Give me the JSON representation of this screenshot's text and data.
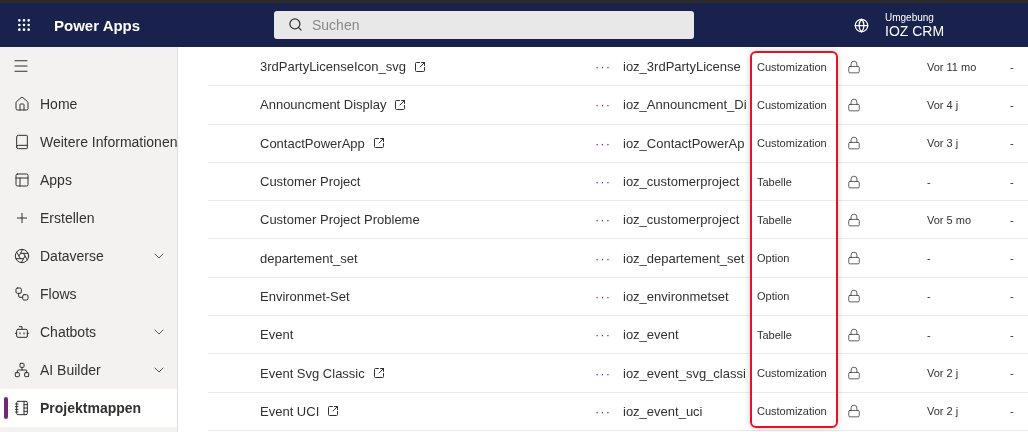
{
  "header": {
    "app_name": "Power Apps",
    "search": {
      "placeholder": "Suchen"
    },
    "environment": {
      "label": "Umgebung",
      "name": "IOZ CRM"
    }
  },
  "sidebar": {
    "items": [
      {
        "label": "Home",
        "has_submenu": false,
        "selected": false
      },
      {
        "label": "Weitere Informationen",
        "has_submenu": false,
        "selected": false
      },
      {
        "label": "Apps",
        "has_submenu": false,
        "selected": false
      },
      {
        "label": "Erstellen",
        "has_submenu": false,
        "selected": false
      },
      {
        "label": "Dataverse",
        "has_submenu": true,
        "selected": false
      },
      {
        "label": "Flows",
        "has_submenu": false,
        "selected": false
      },
      {
        "label": "Chatbots",
        "has_submenu": true,
        "selected": false
      },
      {
        "label": "AI Builder",
        "has_submenu": true,
        "selected": false
      },
      {
        "label": "Projektmappen",
        "has_submenu": false,
        "selected": true
      }
    ]
  },
  "table": {
    "type_column_highlighted": true,
    "rows": [
      {
        "name": "3rdPartyLicenseIcon_svg",
        "external_link": true,
        "more": "···",
        "schema_name": "ioz_3rdPartyLicense",
        "type": "Customization",
        "locked": true,
        "modified": "Vor 11 mo",
        "column_6": "-"
      },
      {
        "name": "Announcment Display",
        "external_link": true,
        "more": "···",
        "schema_name": "ioz_Announcment_Di",
        "type": "Customization",
        "locked": true,
        "modified": "Vor 4 j",
        "column_6": "-"
      },
      {
        "name": "ContactPowerApp",
        "external_link": true,
        "more": "···",
        "schema_name": "ioz_ContactPowerAp",
        "type": "Customization",
        "locked": true,
        "modified": "Vor 3 j",
        "column_6": "-"
      },
      {
        "name": "Customer Project",
        "external_link": false,
        "more": "···",
        "schema_name": "ioz_customerproject",
        "type": "Tabelle",
        "locked": true,
        "modified": "-",
        "column_6": "-"
      },
      {
        "name": "Customer Project Probleme",
        "external_link": false,
        "more": "···",
        "schema_name": "ioz_customerproject",
        "type": "Tabelle",
        "locked": true,
        "modified": "Vor 5 mo",
        "column_6": "-"
      },
      {
        "name": "departement_set",
        "external_link": false,
        "more": "···",
        "schema_name": "ioz_departement_set",
        "type": "Option",
        "locked": true,
        "modified": "-",
        "column_6": "-"
      },
      {
        "name": "Environmet-Set",
        "external_link": false,
        "more": "···",
        "schema_name": "ioz_environmetset",
        "type": "Option",
        "locked": true,
        "modified": "-",
        "column_6": "-"
      },
      {
        "name": "Event",
        "external_link": false,
        "more": "···",
        "schema_name": "ioz_event",
        "type": "Tabelle",
        "locked": true,
        "modified": "-",
        "column_6": "-"
      },
      {
        "name": "Event Svg Classic",
        "external_link": true,
        "more": "···",
        "schema_name": "ioz_event_svg_classi",
        "type": "Customization",
        "locked": true,
        "modified": "Vor 2 j",
        "column_6": "-"
      },
      {
        "name": "Event UCI",
        "external_link": true,
        "more": "···",
        "schema_name": "ioz_event_uci",
        "type": "Customization",
        "locked": true,
        "modified": "Vor 2 j",
        "column_6": "-"
      }
    ]
  }
}
